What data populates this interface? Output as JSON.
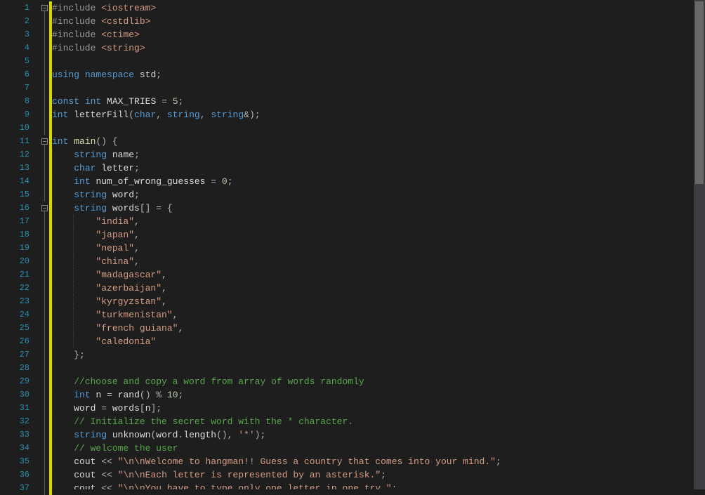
{
  "lines": [
    {
      "n": 1,
      "fold": "box",
      "html": "<span class='tok-pre'>#include</span> <span class='tok-inc'>&lt;iostream&gt;</span>"
    },
    {
      "n": 2,
      "fold": "line",
      "html": "<span class='tok-pre'>#include</span> <span class='tok-inc'>&lt;cstdlib&gt;</span>"
    },
    {
      "n": 3,
      "fold": "line",
      "html": "<span class='tok-pre'>#include</span> <span class='tok-inc'>&lt;ctime&gt;</span>"
    },
    {
      "n": 4,
      "fold": "line",
      "html": "<span class='tok-pre'>#include</span> <span class='tok-inc'>&lt;string&gt;</span>"
    },
    {
      "n": 5,
      "fold": "line",
      "html": ""
    },
    {
      "n": 6,
      "fold": "line",
      "html": "<span class='tok-kw'>using</span> <span class='tok-kw'>namespace</span> <span class='tok-id'>std</span><span class='tok-op'>;</span>"
    },
    {
      "n": 7,
      "fold": "line",
      "html": ""
    },
    {
      "n": 8,
      "fold": "line",
      "html": "<span class='tok-kw'>const</span> <span class='tok-type'>int</span> <span class='tok-id'>MAX_TRIES</span> <span class='tok-op'>=</span> <span class='tok-num'>5</span><span class='tok-op'>;</span>"
    },
    {
      "n": 9,
      "fold": "line",
      "html": "<span class='tok-type'>int</span> <span class='tok-id'>letterFill</span><span class='tok-op'>(</span><span class='tok-type'>char</span><span class='tok-op'>,</span> <span class='tok-type'>string</span><span class='tok-op'>,</span> <span class='tok-type'>string</span><span class='tok-op'>&amp;);</span>"
    },
    {
      "n": 10,
      "fold": "line",
      "html": ""
    },
    {
      "n": 11,
      "fold": "box",
      "html": "<span class='tok-type'>int</span> <span class='tok-func'>main</span><span class='tok-op'>() {</span>",
      "guides": []
    },
    {
      "n": 12,
      "fold": "line",
      "html": "    <span class='tok-type'>string</span> <span class='tok-id'>name</span><span class='tok-op'>;</span>",
      "guides": [
        0
      ]
    },
    {
      "n": 13,
      "fold": "line",
      "html": "    <span class='tok-type'>char</span> <span class='tok-id'>letter</span><span class='tok-op'>;</span>",
      "guides": [
        0
      ]
    },
    {
      "n": 14,
      "fold": "line",
      "html": "    <span class='tok-type'>int</span> <span class='tok-id'>num_of_wrong_guesses</span> <span class='tok-op'>=</span> <span class='tok-num'>0</span><span class='tok-op'>;</span>",
      "guides": [
        0
      ]
    },
    {
      "n": 15,
      "fold": "line",
      "html": "    <span class='tok-type'>string</span> <span class='tok-id'>word</span><span class='tok-op'>;</span>",
      "guides": [
        0
      ]
    },
    {
      "n": 16,
      "fold": "box",
      "html": "    <span class='tok-type'>string</span> <span class='tok-id'>words</span><span class='tok-op'>[] = {</span>",
      "guides": [
        0
      ]
    },
    {
      "n": 17,
      "fold": "line",
      "html": "        <span class='tok-str'>\"india\"</span><span class='tok-op'>,</span>",
      "guides": [
        0,
        1
      ]
    },
    {
      "n": 18,
      "fold": "line",
      "html": "        <span class='tok-str'>\"japan\"</span><span class='tok-op'>,</span>",
      "guides": [
        0,
        1
      ]
    },
    {
      "n": 19,
      "fold": "line",
      "html": "        <span class='tok-str'>\"nepal\"</span><span class='tok-op'>,</span>",
      "guides": [
        0,
        1
      ]
    },
    {
      "n": 20,
      "fold": "line",
      "html": "        <span class='tok-str'>\"china\"</span><span class='tok-op'>,</span>",
      "guides": [
        0,
        1
      ]
    },
    {
      "n": 21,
      "fold": "line",
      "html": "        <span class='tok-str'>\"madagascar\"</span><span class='tok-op'>,</span>",
      "guides": [
        0,
        1
      ]
    },
    {
      "n": 22,
      "fold": "line",
      "html": "        <span class='tok-str'>\"azerbaijan\"</span><span class='tok-op'>,</span>",
      "guides": [
        0,
        1
      ]
    },
    {
      "n": 23,
      "fold": "line",
      "html": "        <span class='tok-str'>\"kyrgyzstan\"</span><span class='tok-op'>,</span>",
      "guides": [
        0,
        1
      ]
    },
    {
      "n": 24,
      "fold": "line",
      "html": "        <span class='tok-str'>\"turkmenistan\"</span><span class='tok-op'>,</span>",
      "guides": [
        0,
        1
      ]
    },
    {
      "n": 25,
      "fold": "line",
      "html": "        <span class='tok-str'>\"french guiana\"</span><span class='tok-op'>,</span>",
      "guides": [
        0,
        1
      ]
    },
    {
      "n": 26,
      "fold": "line",
      "html": "        <span class='tok-str'>\"caledonia\"</span>",
      "guides": [
        0,
        1
      ]
    },
    {
      "n": 27,
      "fold": "line",
      "html": "    <span class='tok-op'>};</span>",
      "guides": [
        0
      ]
    },
    {
      "n": 28,
      "fold": "line",
      "html": "",
      "guides": [
        0
      ]
    },
    {
      "n": 29,
      "fold": "line",
      "html": "    <span class='tok-com'>//choose and copy a word from array of words randomly</span>",
      "guides": [
        0
      ]
    },
    {
      "n": 30,
      "fold": "line",
      "html": "    <span class='tok-type'>int</span> <span class='tok-id'>n</span> <span class='tok-op'>=</span> <span class='tok-id'>rand</span><span class='tok-op'>() %</span> <span class='tok-num'>10</span><span class='tok-op'>;</span>",
      "guides": [
        0
      ]
    },
    {
      "n": 31,
      "fold": "line",
      "html": "    <span class='tok-id'>word</span> <span class='tok-op'>=</span> <span class='tok-id'>words</span><span class='tok-op'>[</span><span class='tok-id'>n</span><span class='tok-op'>];</span>",
      "guides": [
        0
      ]
    },
    {
      "n": 32,
      "fold": "line",
      "html": "    <span class='tok-com'>// Initialize the secret word with the * character.</span>",
      "guides": [
        0
      ]
    },
    {
      "n": 33,
      "fold": "line",
      "html": "    <span class='tok-type'>string</span> <span class='tok-id'>unknown</span><span class='tok-op'>(</span><span class='tok-id'>word</span><span class='tok-op'>.</span><span class='tok-id'>length</span><span class='tok-op'>(),</span> <span class='tok-char'>'*'</span><span class='tok-op'>);</span>",
      "guides": [
        0
      ]
    },
    {
      "n": 34,
      "fold": "line",
      "html": "    <span class='tok-com'>// welcome the user</span>",
      "guides": [
        0
      ]
    },
    {
      "n": 35,
      "fold": "line",
      "html": "    <span class='tok-id'>cout</span> <span class='tok-op'>&lt;&lt;</span> <span class='tok-str'>\"\\n\\nWelcome to hangman!! Guess a country that comes into your mind.\"</span><span class='tok-op'>;</span>",
      "guides": [
        0
      ]
    },
    {
      "n": 36,
      "fold": "line",
      "html": "    <span class='tok-id'>cout</span> <span class='tok-op'>&lt;&lt;</span> <span class='tok-str'>\"\\n\\nEach letter is represented by an asterisk.\"</span><span class='tok-op'>;</span>",
      "guides": [
        0
      ]
    },
    {
      "n": 37,
      "fold": "line",
      "html": "    <span class='tok-id'>cout</span> <span class='tok-op'>&lt;&lt;</span> <span class='tok-str'>\"\\n\\nYou have to type only one letter in one try.\"</span><span class='tok-op'>;</span>",
      "guides": [
        0
      ]
    }
  ],
  "indent_width": 30,
  "base_indent": 0
}
